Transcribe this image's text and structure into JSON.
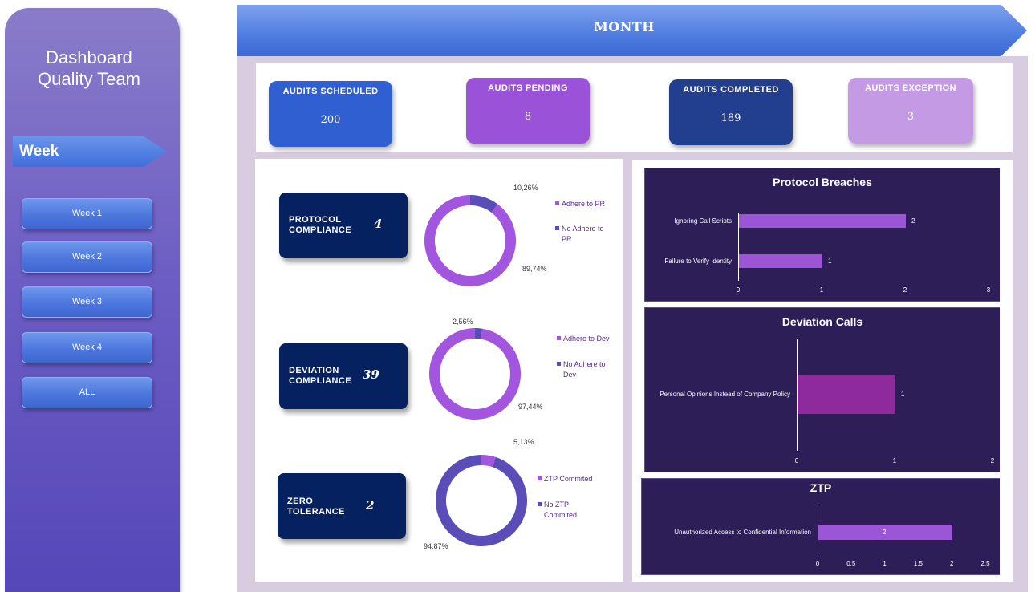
{
  "sidebar": {
    "title_line1": "Dashboard",
    "title_line2": "Quality Team",
    "section_label": "Week",
    "buttons": [
      "Week 1",
      "Week 2",
      "Week 3",
      "Week 4",
      "ALL"
    ]
  },
  "header": {
    "title": "MONTH"
  },
  "kpis": [
    {
      "label": "AUDITS SCHEDULED",
      "value": "200",
      "color": "#2f5fd0"
    },
    {
      "label": "AUDITS PENDING",
      "value": "8",
      "color": "#9a52d8"
    },
    {
      "label": "AUDITS  COMPLETED",
      "value": "189",
      "color": "#223f8f"
    },
    {
      "label": "AUDITS EXCEPTION",
      "value": "3",
      "color": "#c49ae4"
    }
  ],
  "metrics": {
    "protocol": {
      "label_line1": "PROTOCOL",
      "label_line2": "COMPLIANCE",
      "value": "4"
    },
    "deviation": {
      "label_line1": "DEVIATION",
      "label_line2": "COMPLIANCE",
      "value": "39"
    },
    "zero": {
      "label_line1": "ZERO",
      "label_line2": "TOLERANCE",
      "value": "2"
    }
  },
  "donuts": {
    "protocol": {
      "small_pct": "10,26%",
      "large_pct": "89,74%",
      "legend": [
        "Adhere to PR",
        "No Adhere to",
        "PR"
      ],
      "colors": [
        "#a255de",
        "#5a4db8"
      ]
    },
    "deviation": {
      "small_pct": "2,56%",
      "large_pct": "97,44%",
      "legend": [
        "Adhere to Dev",
        "No Adhere to",
        "Dev"
      ],
      "colors": [
        "#a255de",
        "#5a4db8"
      ]
    },
    "zero": {
      "small_pct": "5,13%",
      "large_pct": "94,87%",
      "legend": [
        "ZTP Commited",
        "No ZTP",
        "Commited"
      ],
      "colors": [
        "#a255de",
        "#5a4db8"
      ]
    }
  },
  "chart_data": [
    {
      "type": "bar",
      "title": "Protocol Breaches",
      "categories": [
        "Ignoring Call Scripts",
        "Failure to Verify Identity"
      ],
      "values": [
        2,
        1
      ],
      "xlim": [
        0,
        3
      ],
      "ticks": [
        "0",
        "1",
        "2",
        "3"
      ],
      "value_labels": [
        "2",
        "1"
      ],
      "bar_color": "#9a56d6"
    },
    {
      "type": "bar",
      "title": "Deviation Calls",
      "categories": [
        "Personal Opinions Instead of Company Policy"
      ],
      "values": [
        1
      ],
      "xlim": [
        0,
        2
      ],
      "ticks": [
        "0",
        "1",
        "2"
      ],
      "value_labels": [
        "1"
      ],
      "bar_color": "#8e2a9c"
    },
    {
      "type": "bar",
      "title": "ZTP",
      "categories": [
        "Unauthorized Access to Confidential Information"
      ],
      "values": [
        2
      ],
      "xlim": [
        0,
        2.5
      ],
      "ticks": [
        "0",
        "0,5",
        "1",
        "1,5",
        "2",
        "2,5"
      ],
      "value_labels": [
        "2"
      ],
      "bar_color": "#9a56d6"
    }
  ],
  "donut_values": [
    {
      "name": "protocol",
      "small": 10.26,
      "large": 89.74
    },
    {
      "name": "deviation",
      "small": 2.56,
      "large": 97.44
    },
    {
      "name": "zero",
      "small": 5.13,
      "large": 94.87
    }
  ]
}
